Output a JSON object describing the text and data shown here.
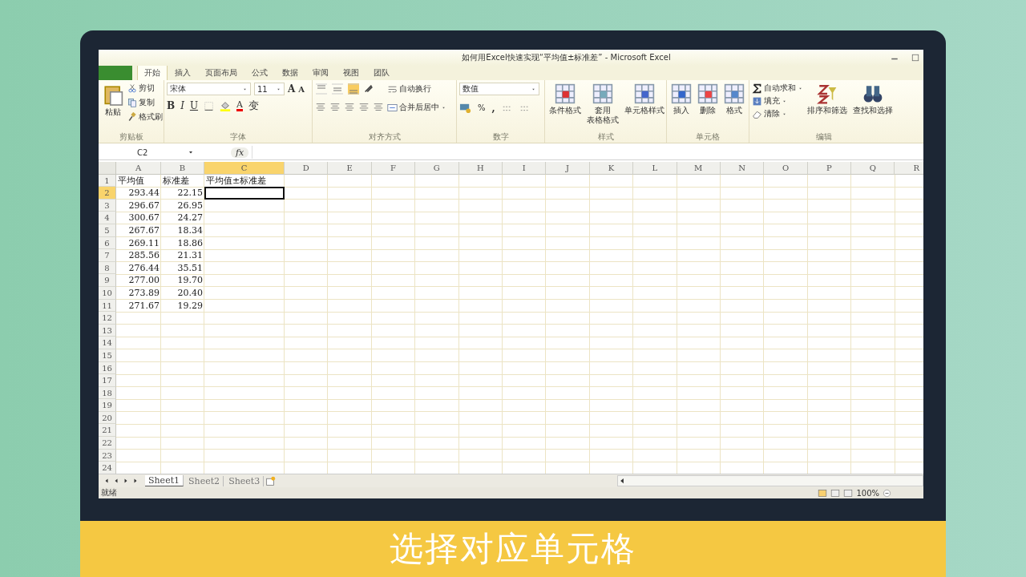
{
  "window": {
    "title": "如何用Excel快速实现“平均值±标准差” - Microsoft Excel"
  },
  "ribbon": {
    "tabs": [
      {
        "kind": "file",
        "selected": false
      },
      {
        "label": "开始",
        "kind": "tab",
        "selected": true
      },
      {
        "label": "插入",
        "kind": "tab",
        "selected": false
      },
      {
        "label": "页面布局",
        "kind": "tab",
        "selected": false
      },
      {
        "label": "公式",
        "kind": "tab",
        "selected": false
      },
      {
        "label": "数据",
        "kind": "tab",
        "selected": false
      },
      {
        "label": "审阅",
        "kind": "tab",
        "selected": false
      },
      {
        "label": "视图",
        "kind": "tab",
        "selected": false
      },
      {
        "label": "团队",
        "kind": "tab",
        "selected": false
      }
    ],
    "clipboard": {
      "label": "剪贴板",
      "paste": "粘贴",
      "items": [
        "剪切",
        "复制",
        "格式刷"
      ]
    },
    "font": {
      "label": "字体",
      "family": "宋体",
      "size": "11",
      "grow": "A",
      "shrink": "A",
      "styles": [
        "B",
        "I",
        "U"
      ],
      "font_color": "A",
      "phonetic": "变"
    },
    "alignment": {
      "label": "对齐方式",
      "wrap": "自动换行",
      "merge": "合并后居中"
    },
    "number": {
      "label": "数字",
      "format": "数值",
      "percent": "%",
      "comma": ","
    },
    "styles": {
      "label": "样式",
      "items": [
        {
          "lines": [
            "条件格式"
          ]
        },
        {
          "lines": [
            "套用",
            "表格格式"
          ]
        },
        {
          "lines": [
            "单元格样式"
          ]
        }
      ]
    },
    "cells": {
      "label": "单元格",
      "items": [
        "插入",
        "删除",
        "格式"
      ]
    },
    "editing": {
      "label": "编辑",
      "items": [
        "自动求和",
        "填充",
        "清除"
      ],
      "big": [
        "排序和筛选",
        "查找和选择"
      ]
    }
  },
  "formula_bar": {
    "name_box": "C2",
    "fx": "fx"
  },
  "columns": [
    {
      "label": "A",
      "selected": false
    },
    {
      "label": "B",
      "selected": false
    },
    {
      "label": "C",
      "selected": true
    },
    {
      "label": "D",
      "selected": false
    },
    {
      "label": "E",
      "selected": false
    },
    {
      "label": "F",
      "selected": false
    },
    {
      "label": "G",
      "selected": false
    },
    {
      "label": "H",
      "selected": false
    },
    {
      "label": "I",
      "selected": false
    },
    {
      "label": "J",
      "selected": false
    },
    {
      "label": "K",
      "selected": false
    },
    {
      "label": "L",
      "selected": false
    },
    {
      "label": "M",
      "selected": false
    },
    {
      "label": "N",
      "selected": false
    },
    {
      "label": "O",
      "selected": false
    },
    {
      "label": "P",
      "selected": false
    },
    {
      "label": "Q",
      "selected": false
    },
    {
      "label": "R",
      "selected": false
    }
  ],
  "rows": [
    {
      "label": "1",
      "selected": false,
      "kind": "text",
      "cells": [
        "平均值",
        "标准差",
        "平均值±标准差"
      ]
    },
    {
      "label": "2",
      "selected": true,
      "kind": "number",
      "cells": [
        "293.44",
        "22.15"
      ]
    },
    {
      "label": "3",
      "selected": false,
      "kind": "number",
      "cells": [
        "296.67",
        "26.95"
      ]
    },
    {
      "label": "4",
      "selected": false,
      "kind": "number",
      "cells": [
        "300.67",
        "24.27"
      ]
    },
    {
      "label": "5",
      "selected": false,
      "kind": "number",
      "cells": [
        "267.67",
        "18.34"
      ]
    },
    {
      "label": "6",
      "selected": false,
      "kind": "number",
      "cells": [
        "269.11",
        "18.86"
      ]
    },
    {
      "label": "7",
      "selected": false,
      "kind": "number",
      "cells": [
        "285.56",
        "21.31"
      ]
    },
    {
      "label": "8",
      "selected": false,
      "kind": "number",
      "cells": [
        "276.44",
        "35.51"
      ]
    },
    {
      "label": "9",
      "selected": false,
      "kind": "number",
      "cells": [
        "277.00",
        "19.70"
      ]
    },
    {
      "label": "10",
      "selected": false,
      "kind": "number",
      "cells": [
        "273.89",
        "20.40"
      ]
    },
    {
      "label": "11",
      "selected": false,
      "kind": "number",
      "cells": [
        "271.67",
        "19.29"
      ]
    },
    {
      "label": "12",
      "selected": false
    },
    {
      "label": "13",
      "selected": false
    },
    {
      "label": "14",
      "selected": false
    },
    {
      "label": "15",
      "selected": false
    },
    {
      "label": "16",
      "selected": false
    },
    {
      "label": "17",
      "selected": false
    },
    {
      "label": "18",
      "selected": false
    },
    {
      "label": "19",
      "selected": false
    },
    {
      "label": "20",
      "selected": false
    },
    {
      "label": "21",
      "selected": false
    },
    {
      "label": "22",
      "selected": false
    },
    {
      "label": "23",
      "selected": false
    },
    {
      "label": "24",
      "selected": false
    }
  ],
  "sheets": [
    {
      "label": "Sheet1",
      "selected": true
    },
    {
      "label": "Sheet2",
      "selected": false
    },
    {
      "label": "Sheet3",
      "selected": false
    }
  ],
  "status_bar": {
    "status": "就绪",
    "zoom": "100%"
  },
  "caption": "选择对应单元格"
}
